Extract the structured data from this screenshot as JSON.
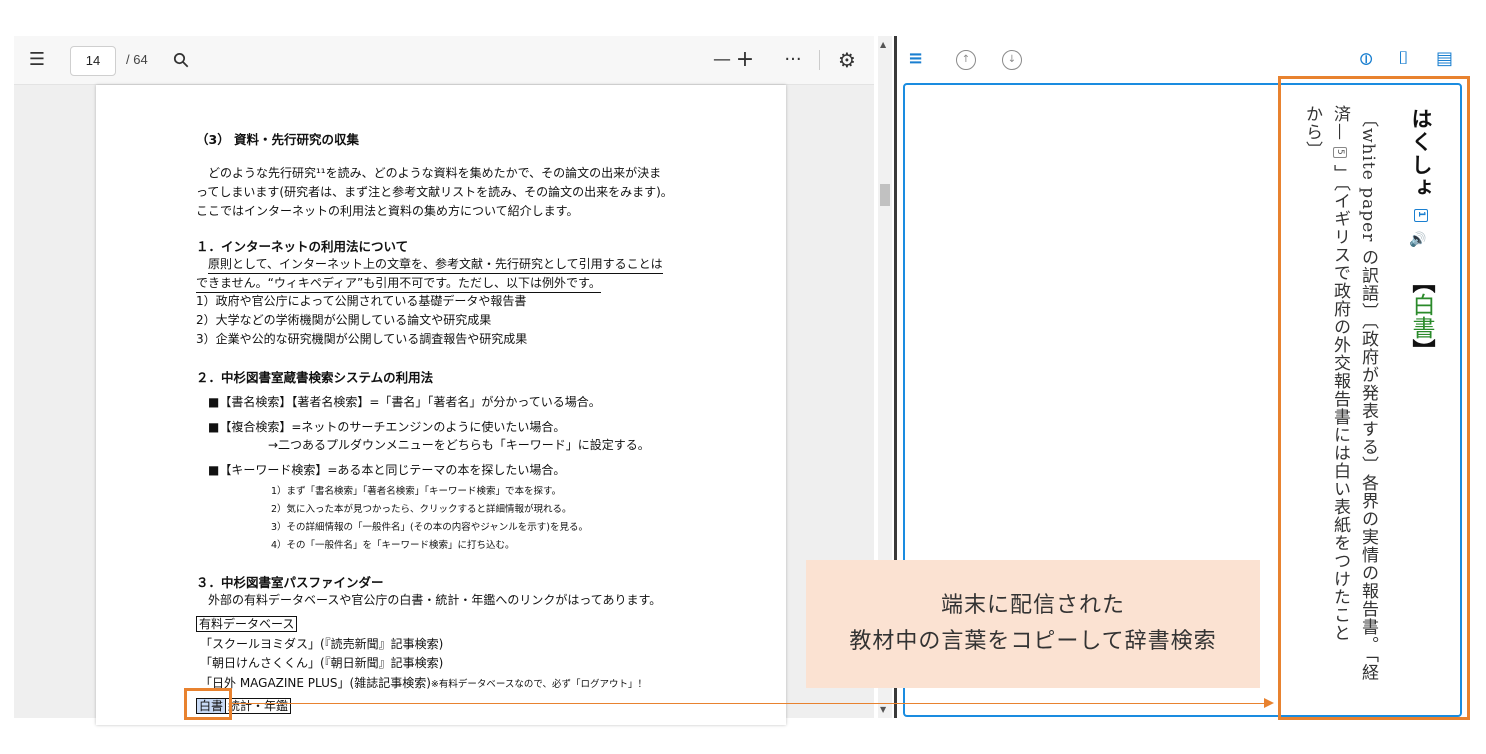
{
  "toolbar": {
    "contents_icon": "☰",
    "page_current": "14",
    "page_total": "/ 64",
    "search_icon": "⚲",
    "zoom_out": "—",
    "zoom_in": "+",
    "more": "···",
    "settings_icon": "⚙"
  },
  "doc": {
    "section_heading": "（3） 資料・先行研究の収集",
    "intro_lines": [
      "どのような先行研究¹¹を読み、どのような資料を集めたかで、その論文の出来が決ま",
      "ってしまいます(研究者は、まず注と参考文献リストを読み、その論文の出来をみます)。",
      "ここではインターネットの利用法と資料の集め方について紹介します。"
    ],
    "s1": {
      "heading": "１．インターネットの利用法について",
      "line1": "原則として、インターネット上の文章を、参考文献・先行研究として引用することは",
      "line2": "できません。“ウィキペディア”も引用不可です。ただし、以下は例外です。",
      "items": [
        "1）政府や官公庁によって公開されている基礎データや報告書",
        "2）大学などの学術機関が公開している論文や研究成果",
        "3）企業や公的な研究機関が公開している調査報告や研究成果"
      ]
    },
    "s2": {
      "heading": "２．中杉図書室蔵書検索システムの利用法",
      "b1": "■【書名検索】【著者名検索】=「書名」「著者名」が分かっている場合。",
      "b2": "■【複合検索】=ネットのサーチエンジンのように使いたい場合。",
      "b2_sub": "→二つあるプルダウンメニューをどちらも「キーワード」に設定する。",
      "b3": "■【キーワード検索】=ある本と同じテーマの本を探したい場合。",
      "steps": [
        "1）まず「書名検索」「著者名検索」「キーワード検索」で本を探す。",
        "2）気に入った本が見つかったら、クリックすると詳細情報が現れる。",
        "3）その詳細情報の「一般件名」(その本の内容やジャンルを示す)を見る。",
        "4）その「一般件名」を「キーワード検索」に打ち込む。"
      ]
    },
    "s3": {
      "heading": "３．中杉図書室パスファインダー",
      "line1": "外部の有料データベースや官公庁の白書・統計・年鑑へのリンクがはってあります。",
      "paid_label": "有料データベース",
      "db1": "「スクールヨミダス」(『読売新聞』記事検索)",
      "db2": "「朝日けんさくくん」(『朝日新聞』記事検索)",
      "db3": "「日外 MAGAZINE PLUS」(雑誌記事検索)",
      "db3_note": "※有料データベースなので、必ず「ログアウト」！",
      "selected_word": "白書",
      "rest_label": "統計・年鑑"
    }
  },
  "dict": {
    "toolbar": {
      "list_icon": "≡",
      "up_icon": "↑",
      "down_icon": "↓",
      "link_icon": "⊖",
      "bookmark_icon": "⌷",
      "memo_icon": "▤"
    },
    "headword": "はくしょ",
    "accent_num": "1",
    "speaker_icon": "🔊",
    "kanji_open": "【",
    "kanji": "白書",
    "kanji_close": "】",
    "def_line1": "〔white paper の訳語〕〔政府が発表する〕各界の実情の報告書。「経",
    "def_line2_a": "済—",
    "def_line2_num": "5",
    "def_line2_b": "」〔イギリスで政府の外交報告書には白い表紙をつけたこと",
    "def_line3": "から〕"
  },
  "caption": {
    "line1": "端末に配信された",
    "line2": "教材中の言葉をコピーして辞書検索"
  }
}
